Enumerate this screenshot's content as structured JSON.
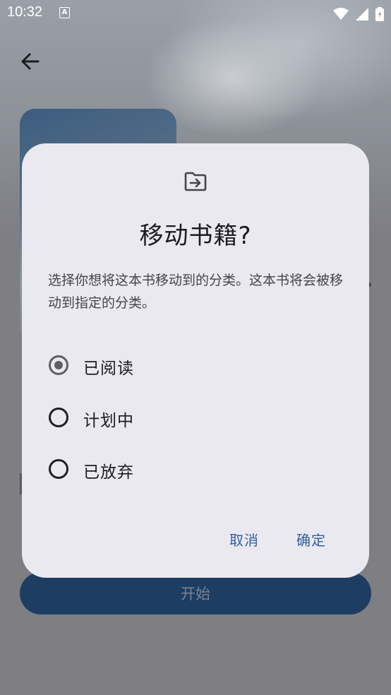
{
  "status_bar": {
    "time": "10:32",
    "notification_icon": "A"
  },
  "background": {
    "start_button_label": "开始"
  },
  "dialog": {
    "title": "移动书籍?",
    "description": "选择你想将这本书移动到的分类。这本书将会被移动到指定的分类。",
    "options": [
      {
        "label": "已阅读",
        "selected": true
      },
      {
        "label": "计划中",
        "selected": false
      },
      {
        "label": "已放弃",
        "selected": false
      }
    ],
    "cancel_label": "取消",
    "confirm_label": "确定"
  },
  "colors": {
    "accent": "#305f9e",
    "dialog_bg": "#ebe9f0",
    "scrim": "#7e7e83",
    "start_button": "#1d3d63"
  },
  "icons": {
    "back": "arrow-left-icon",
    "dialog": "folder-move-icon",
    "wifi": "wifi-icon",
    "signal": "signal-icon",
    "battery": "battery-icon"
  }
}
